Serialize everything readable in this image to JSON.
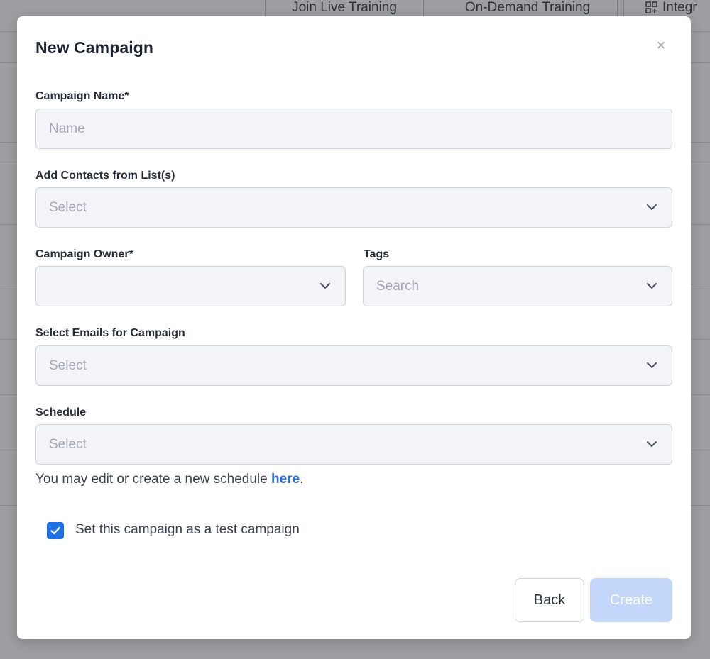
{
  "background": {
    "tabs": [
      "Join Live Training",
      "On-Demand Training",
      "Integr"
    ]
  },
  "modal": {
    "title": "New Campaign",
    "close_icon": "×",
    "fields": {
      "campaign_name": {
        "label": "Campaign Name*",
        "placeholder": "Name",
        "value": ""
      },
      "contact_lists": {
        "label": "Add Contacts from List(s)",
        "placeholder": "Select"
      },
      "owner": {
        "label": "Campaign Owner*",
        "value": ""
      },
      "tags": {
        "label": "Tags",
        "placeholder": "Search"
      },
      "emails": {
        "label": "Select Emails for Campaign",
        "placeholder": "Select"
      },
      "schedule": {
        "label": "Schedule",
        "placeholder": "Select"
      }
    },
    "helper": {
      "prefix": "You may edit or create a new schedule ",
      "link": "here",
      "suffix": "."
    },
    "test_checkbox": {
      "label": "Set this campaign as a test campaign",
      "checked": true
    },
    "buttons": {
      "back": "Back",
      "create": "Create"
    }
  },
  "colors": {
    "accent": "#1f6fe5",
    "link": "#2c6fe0",
    "create_disabled": "#c3d7fb",
    "field_bg": "#f3f4f8"
  }
}
